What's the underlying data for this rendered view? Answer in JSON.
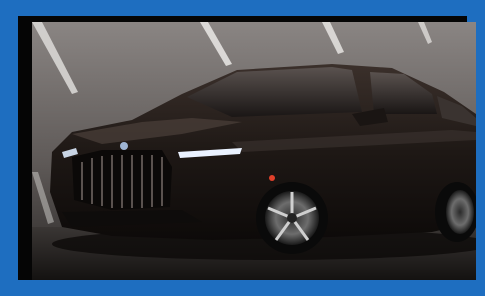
{
  "image": {
    "subject": "car-photo",
    "frame_color": "#1e6ec0",
    "mat_color": "#050505"
  }
}
